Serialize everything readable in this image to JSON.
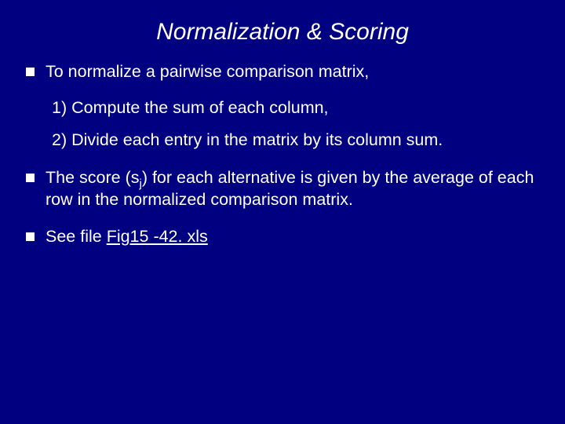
{
  "title": "Normalization & Scoring",
  "bullets": {
    "b1": "To normalize a pairwise comparison matrix,",
    "b1_sub1": "1) Compute the sum of each column,",
    "b1_sub2": "2) Divide each entry in the matrix by its column sum.",
    "b2_pre": "The score (s",
    "b2_sub": "j",
    "b2_post": ") for each alternative is given by the average of each row in the normalized comparison matrix.",
    "b3_pre": "See file ",
    "b3_link": "Fig15 -42. xls"
  }
}
